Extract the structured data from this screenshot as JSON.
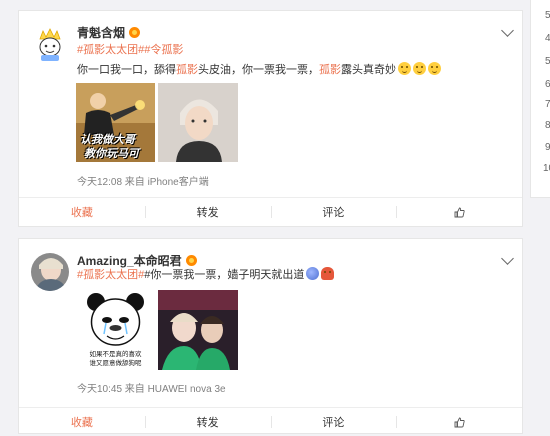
{
  "sidebar": {
    "numbers": [
      "5",
      "4",
      "5",
      "6",
      "7",
      "8",
      "9",
      "10"
    ]
  },
  "post1": {
    "username": "青魁含烟",
    "avatar_icon": "cartoon-face-icon",
    "tags": [
      "#孤影太太团#",
      "#令孤影"
    ],
    "content_pre": "你一口我一口，舔得",
    "content_hl1": "孤影",
    "content_mid": "头皮油，你一票我一票，",
    "content_hl2": "孤影",
    "content_post": "露头真奇妙",
    "image1_text_line1": "认我做大哥",
    "image1_text_line2": "教你玩马可",
    "meta": "今天12:08 来自 iPhone客户端",
    "actions": {
      "favorite": "收藏",
      "repost": "转发",
      "comment": "评论",
      "like_icon": "thumbs-up-icon"
    }
  },
  "post2": {
    "username": "Amazing_本命昭君",
    "tags": [
      "#孤影太太团#"
    ],
    "content": "#你一票我一票，嫱子明天就出道",
    "image1_caption_line1": "如果不是真的喜欢",
    "image1_caption_line2": "谁又愿意做舔狗呢",
    "meta": "今天10:45 来自 HUAWEI nova 3e",
    "actions": {
      "favorite": "收藏",
      "repost": "转发",
      "comment": "评论",
      "like_icon": "thumbs-up-icon"
    }
  },
  "colors": {
    "accent": "#eb7350",
    "link": "#eb7350",
    "meta": "#808080",
    "background": "#f2f2f5"
  }
}
